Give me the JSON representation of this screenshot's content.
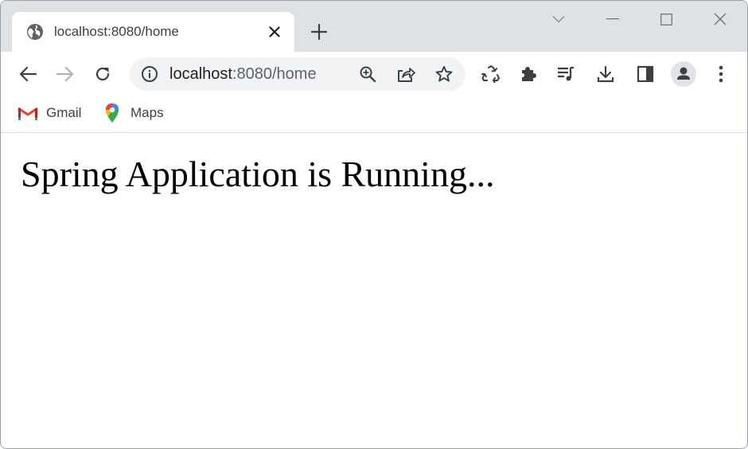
{
  "tab": {
    "title": "localhost:8080/home",
    "favicon": "globe-icon"
  },
  "omnibox": {
    "url_host": "localhost",
    "url_rest": ":8080/home"
  },
  "bookmarks": [
    {
      "label": "Gmail",
      "icon": "gmail-icon"
    },
    {
      "label": "Maps",
      "icon": "maps-icon"
    }
  ],
  "page": {
    "heading": "Spring Application is Running..."
  },
  "colors": {
    "tabstrip": "#dee1e6",
    "omnibox": "#f1f3f4",
    "icon": "#5f6368",
    "text": "#202124"
  }
}
